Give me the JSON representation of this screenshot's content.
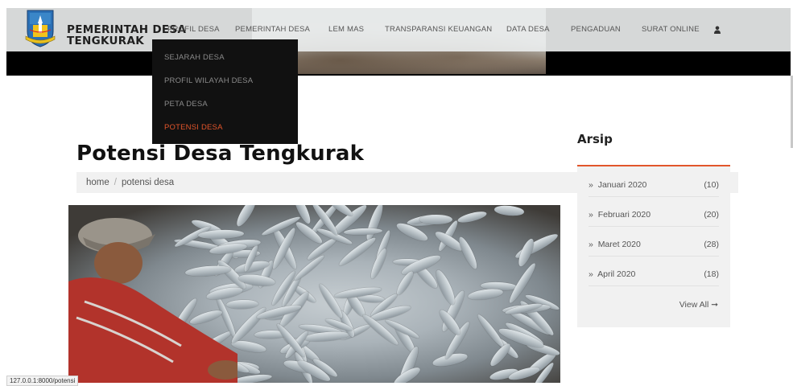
{
  "brand": {
    "line1": "PEMERINTAH DESA",
    "line2": "TENGKURAK"
  },
  "nav": {
    "items": [
      {
        "label": "PROFIL DESA"
      },
      {
        "label": "PEMERINTAH DESA"
      },
      {
        "label": "LEM MAS"
      },
      {
        "label": "TRANSPARANSI KEUANGAN"
      },
      {
        "label": "DATA DESA"
      },
      {
        "label": "PENGADUAN"
      },
      {
        "label": "SURAT ONLINE"
      }
    ]
  },
  "dropdown": {
    "items": [
      {
        "label": "SEJARAH DESA"
      },
      {
        "label": "PROFIL WILAYAH DESA"
      },
      {
        "label": "PETA DESA"
      },
      {
        "label": "POTENSI DESA",
        "active": true
      }
    ]
  },
  "page": {
    "title": "Potensi Desa Tengkurak",
    "breadcrumb": [
      "home",
      "potensi desa"
    ]
  },
  "sidebar": {
    "title": "Arsip",
    "items": [
      {
        "label": "Januari 2020",
        "count": "(10)"
      },
      {
        "label": "Februari 2020",
        "count": "(20)"
      },
      {
        "label": "Maret 2020",
        "count": "(28)"
      },
      {
        "label": "April 2020",
        "count": "(18)"
      }
    ],
    "bullet": "»",
    "view_all": "View All ➞"
  },
  "status_bar": {
    "url": "127.0.0.1:8000/potensi"
  },
  "colors": {
    "accent": "#e2552b",
    "nav_bg": "#e8eaea",
    "dropdown_bg": "#111111"
  },
  "icons": {
    "user": "user-icon",
    "logo": "village-emblem"
  }
}
